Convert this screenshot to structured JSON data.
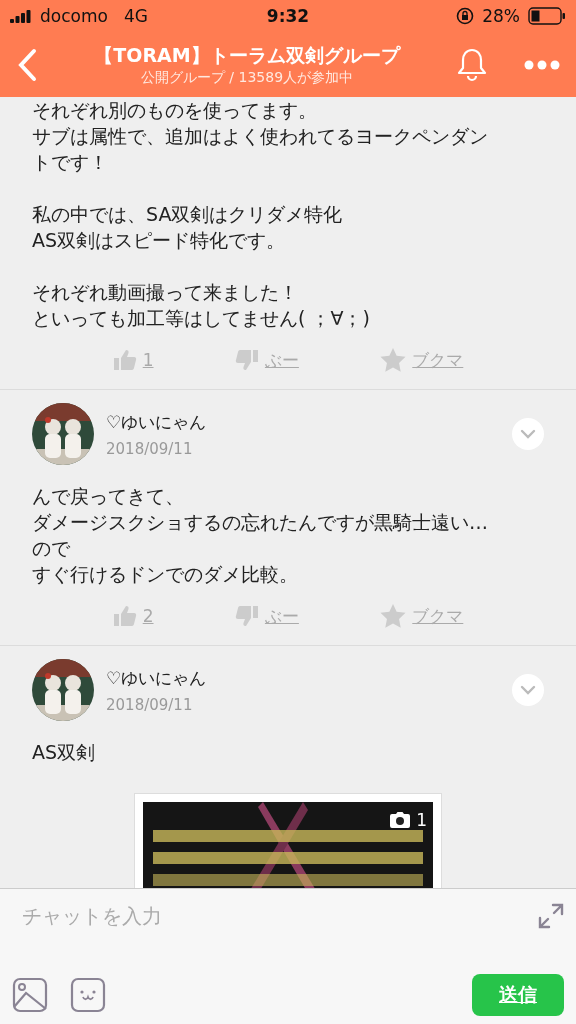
{
  "status_bar": {
    "carrier": "docomo",
    "network": "4G",
    "time": "9:32",
    "battery": "28%"
  },
  "header": {
    "title": "【TORAM】トーラム双剣グループ",
    "subtitle": "公開グループ / 13589人が参加中"
  },
  "posts": [
    {
      "paragraphs": [
        [
          "それぞれ別のものを使ってます。",
          "サブは属性で、追加はよく使われてるヨークペンダン",
          "トです！"
        ],
        [
          "私の中では、SA双剣はクリダメ特化",
          "AS双剣はスピード特化です。"
        ],
        [
          "それぞれ動画撮って来ました！",
          "といっても加工等はしてません( ；∀；)"
        ]
      ],
      "reactions": {
        "likes": "1",
        "boo": "ぶー",
        "bookmark": "ブクマ"
      }
    },
    {
      "author": "♡ゆいにゃん",
      "date": "2018/09/11",
      "paragraphs": [
        [
          "んで戻ってきて、",
          "ダメージスクショするの忘れたんですが黒騎士遠い…",
          "ので",
          "すぐ行けるドンでのダメ比較。"
        ]
      ],
      "reactions": {
        "likes": "2",
        "boo": "ぶー",
        "bookmark": "ブクマ"
      }
    },
    {
      "author": "♡ゆいにゃん",
      "date": "2018/09/11",
      "paragraphs": [
        [
          "AS双剣"
        ]
      ],
      "image": {
        "kind": "picture",
        "count": "1"
      }
    }
  ],
  "composer": {
    "placeholder": "チャットを入力",
    "send": "送信"
  }
}
